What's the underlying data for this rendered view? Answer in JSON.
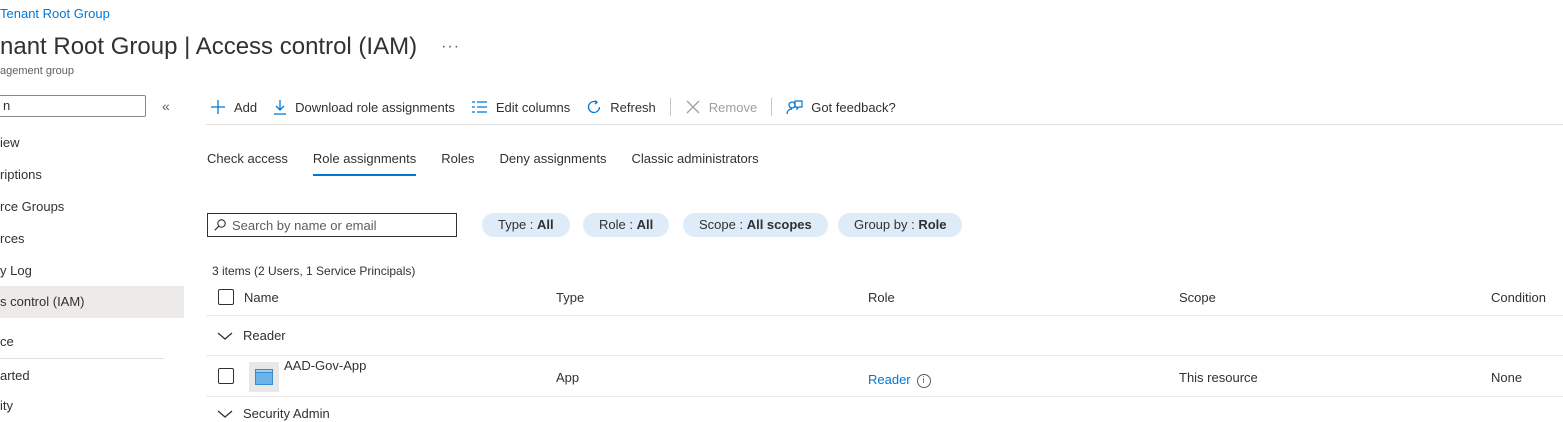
{
  "breadcrumb": "Tenant Root Group",
  "page": {
    "title": "nant Root Group | Access control (IAM)",
    "more": "···",
    "subtitle": "agement group"
  },
  "nav": {
    "search_value": "n",
    "collapse": "«",
    "items": [
      {
        "label": "iew"
      },
      {
        "label": "riptions"
      },
      {
        "label": "rce Groups"
      },
      {
        "label": "rces"
      },
      {
        "label": "y Log"
      },
      {
        "label": "s control (IAM)",
        "active": true
      },
      {
        "label": "ce"
      },
      {
        "label": "arted"
      },
      {
        "label": "ity"
      }
    ]
  },
  "toolbar": {
    "add": "Add",
    "download": "Download role assignments",
    "edit_columns": "Edit columns",
    "refresh": "Refresh",
    "remove": "Remove",
    "feedback": "Got feedback?"
  },
  "tabs": [
    {
      "label": "Check access"
    },
    {
      "label": "Role assignments",
      "active": true
    },
    {
      "label": "Roles"
    },
    {
      "label": "Deny assignments"
    },
    {
      "label": "Classic administrators"
    }
  ],
  "filters": {
    "search_placeholder": "Search by name or email",
    "type": {
      "key": "Type : ",
      "value": "All"
    },
    "role": {
      "key": "Role : ",
      "value": "All"
    },
    "scope": {
      "key": "Scope : ",
      "value": "All scopes"
    },
    "group_by": {
      "key": "Group by : ",
      "value": "Role"
    }
  },
  "summary": "3 items (2 Users, 1 Service Principals)",
  "grid": {
    "columns": {
      "name": "Name",
      "type": "Type",
      "role": "Role",
      "scope": "Scope",
      "condition": "Condition"
    },
    "groups": [
      {
        "label": "Reader",
        "rows": [
          {
            "name": "AAD-Gov-App",
            "type": "App",
            "role": "Reader",
            "scope": "This resource",
            "condition": "None"
          }
        ]
      },
      {
        "label": "Security Admin"
      }
    ]
  },
  "colors": {
    "accent": "#0078d4",
    "pill_bg": "#deecf9",
    "active_nav": "#edebe9"
  }
}
